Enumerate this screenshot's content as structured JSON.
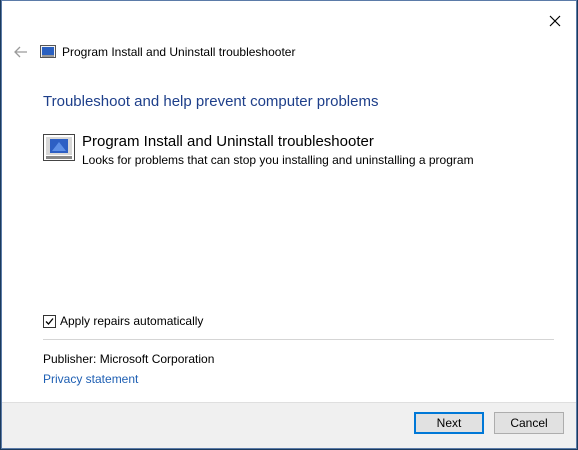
{
  "header": {
    "title": "Program Install and Uninstall troubleshooter"
  },
  "main": {
    "heading": "Troubleshoot and help prevent computer problems",
    "task": {
      "title": "Program Install and Uninstall troubleshooter",
      "description": "Looks for problems that can stop you installing and uninstalling a program"
    },
    "apply_repairs": {
      "label": "Apply repairs automatically",
      "checked": true
    },
    "publisher_line": "Publisher:  Microsoft Corporation",
    "privacy_link": "Privacy statement"
  },
  "footer": {
    "next_label": "Next",
    "cancel_label": "Cancel"
  },
  "icons": {
    "close": "close-icon",
    "back": "back-arrow-icon",
    "troubleshooter": "troubleshooter-icon"
  },
  "colors": {
    "heading": "#1e3f8a",
    "link": "#1e5fb3",
    "accent": "#0078d7"
  }
}
